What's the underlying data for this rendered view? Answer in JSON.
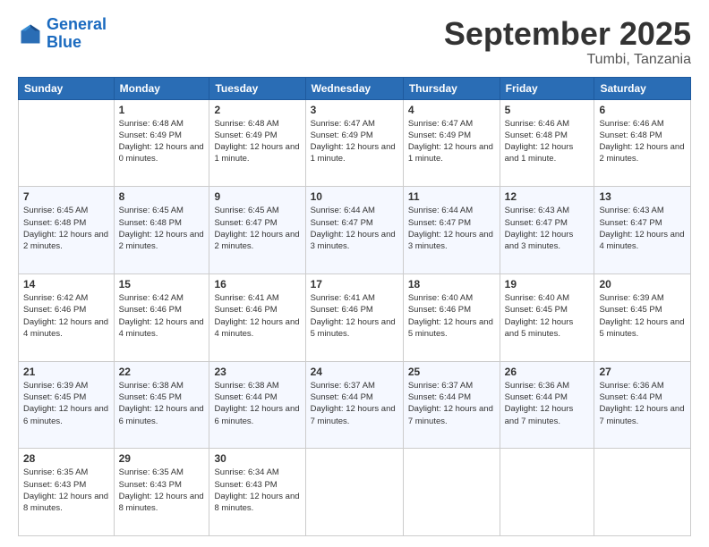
{
  "logo": {
    "line1": "General",
    "line2": "Blue"
  },
  "title": "September 2025",
  "subtitle": "Tumbi, Tanzania",
  "days_of_week": [
    "Sunday",
    "Monday",
    "Tuesday",
    "Wednesday",
    "Thursday",
    "Friday",
    "Saturday"
  ],
  "weeks": [
    [
      {
        "day": "",
        "sunrise": "",
        "sunset": "",
        "daylight": ""
      },
      {
        "day": "1",
        "sunrise": "Sunrise: 6:48 AM",
        "sunset": "Sunset: 6:49 PM",
        "daylight": "Daylight: 12 hours and 0 minutes."
      },
      {
        "day": "2",
        "sunrise": "Sunrise: 6:48 AM",
        "sunset": "Sunset: 6:49 PM",
        "daylight": "Daylight: 12 hours and 1 minute."
      },
      {
        "day": "3",
        "sunrise": "Sunrise: 6:47 AM",
        "sunset": "Sunset: 6:49 PM",
        "daylight": "Daylight: 12 hours and 1 minute."
      },
      {
        "day": "4",
        "sunrise": "Sunrise: 6:47 AM",
        "sunset": "Sunset: 6:49 PM",
        "daylight": "Daylight: 12 hours and 1 minute."
      },
      {
        "day": "5",
        "sunrise": "Sunrise: 6:46 AM",
        "sunset": "Sunset: 6:48 PM",
        "daylight": "Daylight: 12 hours and 1 minute."
      },
      {
        "day": "6",
        "sunrise": "Sunrise: 6:46 AM",
        "sunset": "Sunset: 6:48 PM",
        "daylight": "Daylight: 12 hours and 2 minutes."
      }
    ],
    [
      {
        "day": "7",
        "sunrise": "Sunrise: 6:45 AM",
        "sunset": "Sunset: 6:48 PM",
        "daylight": "Daylight: 12 hours and 2 minutes."
      },
      {
        "day": "8",
        "sunrise": "Sunrise: 6:45 AM",
        "sunset": "Sunset: 6:48 PM",
        "daylight": "Daylight: 12 hours and 2 minutes."
      },
      {
        "day": "9",
        "sunrise": "Sunrise: 6:45 AM",
        "sunset": "Sunset: 6:47 PM",
        "daylight": "Daylight: 12 hours and 2 minutes."
      },
      {
        "day": "10",
        "sunrise": "Sunrise: 6:44 AM",
        "sunset": "Sunset: 6:47 PM",
        "daylight": "Daylight: 12 hours and 3 minutes."
      },
      {
        "day": "11",
        "sunrise": "Sunrise: 6:44 AM",
        "sunset": "Sunset: 6:47 PM",
        "daylight": "Daylight: 12 hours and 3 minutes."
      },
      {
        "day": "12",
        "sunrise": "Sunrise: 6:43 AM",
        "sunset": "Sunset: 6:47 PM",
        "daylight": "Daylight: 12 hours and 3 minutes."
      },
      {
        "day": "13",
        "sunrise": "Sunrise: 6:43 AM",
        "sunset": "Sunset: 6:47 PM",
        "daylight": "Daylight: 12 hours and 4 minutes."
      }
    ],
    [
      {
        "day": "14",
        "sunrise": "Sunrise: 6:42 AM",
        "sunset": "Sunset: 6:46 PM",
        "daylight": "Daylight: 12 hours and 4 minutes."
      },
      {
        "day": "15",
        "sunrise": "Sunrise: 6:42 AM",
        "sunset": "Sunset: 6:46 PM",
        "daylight": "Daylight: 12 hours and 4 minutes."
      },
      {
        "day": "16",
        "sunrise": "Sunrise: 6:41 AM",
        "sunset": "Sunset: 6:46 PM",
        "daylight": "Daylight: 12 hours and 4 minutes."
      },
      {
        "day": "17",
        "sunrise": "Sunrise: 6:41 AM",
        "sunset": "Sunset: 6:46 PM",
        "daylight": "Daylight: 12 hours and 5 minutes."
      },
      {
        "day": "18",
        "sunrise": "Sunrise: 6:40 AM",
        "sunset": "Sunset: 6:46 PM",
        "daylight": "Daylight: 12 hours and 5 minutes."
      },
      {
        "day": "19",
        "sunrise": "Sunrise: 6:40 AM",
        "sunset": "Sunset: 6:45 PM",
        "daylight": "Daylight: 12 hours and 5 minutes."
      },
      {
        "day": "20",
        "sunrise": "Sunrise: 6:39 AM",
        "sunset": "Sunset: 6:45 PM",
        "daylight": "Daylight: 12 hours and 5 minutes."
      }
    ],
    [
      {
        "day": "21",
        "sunrise": "Sunrise: 6:39 AM",
        "sunset": "Sunset: 6:45 PM",
        "daylight": "Daylight: 12 hours and 6 minutes."
      },
      {
        "day": "22",
        "sunrise": "Sunrise: 6:38 AM",
        "sunset": "Sunset: 6:45 PM",
        "daylight": "Daylight: 12 hours and 6 minutes."
      },
      {
        "day": "23",
        "sunrise": "Sunrise: 6:38 AM",
        "sunset": "Sunset: 6:44 PM",
        "daylight": "Daylight: 12 hours and 6 minutes."
      },
      {
        "day": "24",
        "sunrise": "Sunrise: 6:37 AM",
        "sunset": "Sunset: 6:44 PM",
        "daylight": "Daylight: 12 hours and 7 minutes."
      },
      {
        "day": "25",
        "sunrise": "Sunrise: 6:37 AM",
        "sunset": "Sunset: 6:44 PM",
        "daylight": "Daylight: 12 hours and 7 minutes."
      },
      {
        "day": "26",
        "sunrise": "Sunrise: 6:36 AM",
        "sunset": "Sunset: 6:44 PM",
        "daylight": "Daylight: 12 hours and 7 minutes."
      },
      {
        "day": "27",
        "sunrise": "Sunrise: 6:36 AM",
        "sunset": "Sunset: 6:44 PM",
        "daylight": "Daylight: 12 hours and 7 minutes."
      }
    ],
    [
      {
        "day": "28",
        "sunrise": "Sunrise: 6:35 AM",
        "sunset": "Sunset: 6:43 PM",
        "daylight": "Daylight: 12 hours and 8 minutes."
      },
      {
        "day": "29",
        "sunrise": "Sunrise: 6:35 AM",
        "sunset": "Sunset: 6:43 PM",
        "daylight": "Daylight: 12 hours and 8 minutes."
      },
      {
        "day": "30",
        "sunrise": "Sunrise: 6:34 AM",
        "sunset": "Sunset: 6:43 PM",
        "daylight": "Daylight: 12 hours and 8 minutes."
      },
      {
        "day": "",
        "sunrise": "",
        "sunset": "",
        "daylight": ""
      },
      {
        "day": "",
        "sunrise": "",
        "sunset": "",
        "daylight": ""
      },
      {
        "day": "",
        "sunrise": "",
        "sunset": "",
        "daylight": ""
      },
      {
        "day": "",
        "sunrise": "",
        "sunset": "",
        "daylight": ""
      }
    ]
  ]
}
